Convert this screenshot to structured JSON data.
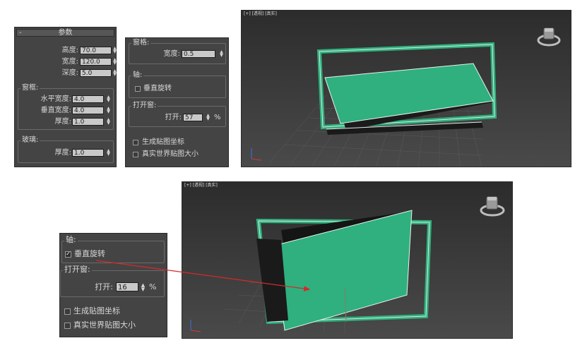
{
  "params_panel": {
    "header": "参数",
    "collapse_glyph": "-",
    "height": {
      "label": "高度:",
      "value": "70.0"
    },
    "width": {
      "label": "宽度:",
      "value": "120.0"
    },
    "depth": {
      "label": "深度:",
      "value": "5.0"
    },
    "frame": {
      "title": "窗框:",
      "h_width": {
        "label": "水平宽度:",
        "value": "4.0"
      },
      "v_width": {
        "label": "垂直宽度:",
        "value": "4.0"
      },
      "thickness": {
        "label": "厚度:",
        "value": "1.0"
      }
    },
    "glass": {
      "title": "玻璃:",
      "thickness": {
        "label": "厚度:",
        "value": "1.0"
      }
    }
  },
  "options_panel": {
    "casement": {
      "title": "窗格:",
      "width": {
        "label": "宽度:",
        "value": "0.5"
      }
    },
    "axis": {
      "title": "轴:",
      "vertical_rotation": {
        "label": "垂直旋转",
        "checked": false
      }
    },
    "open_window": {
      "title": "打开窗:",
      "open": {
        "label": "打开:",
        "value": "57",
        "unit": "%"
      }
    },
    "gen_mapping": {
      "label": "生成贴图坐标",
      "checked": false
    },
    "real_world": {
      "label": "真实世界贴图大小",
      "checked": false
    }
  },
  "viewport_top": {
    "label": "[+] [透视] [真实]"
  },
  "viewport_bottom": {
    "label": "[+] [透视] [真实]"
  },
  "zoom_panel": {
    "axis": {
      "title": "轴:",
      "vertical_rotation": {
        "label": "垂直旋转",
        "checked": true
      }
    },
    "open_window": {
      "title": "打开窗:",
      "open": {
        "label": "打开:",
        "value": "16",
        "unit": "%"
      }
    },
    "gen_mapping": {
      "label": "生成贴图坐标",
      "checked": false
    },
    "real_world": {
      "label": "真实世界贴图大小",
      "checked": false
    }
  },
  "colors": {
    "window_green": "#2fb07e",
    "arrow_red": "#d42a2a",
    "panel_bg": "#444444",
    "viewport_bg": "#3e3e3e"
  },
  "icons": [
    "spinner-icon",
    "viewcube-icon",
    "checkbox-icon",
    "arrow-annotation"
  ]
}
